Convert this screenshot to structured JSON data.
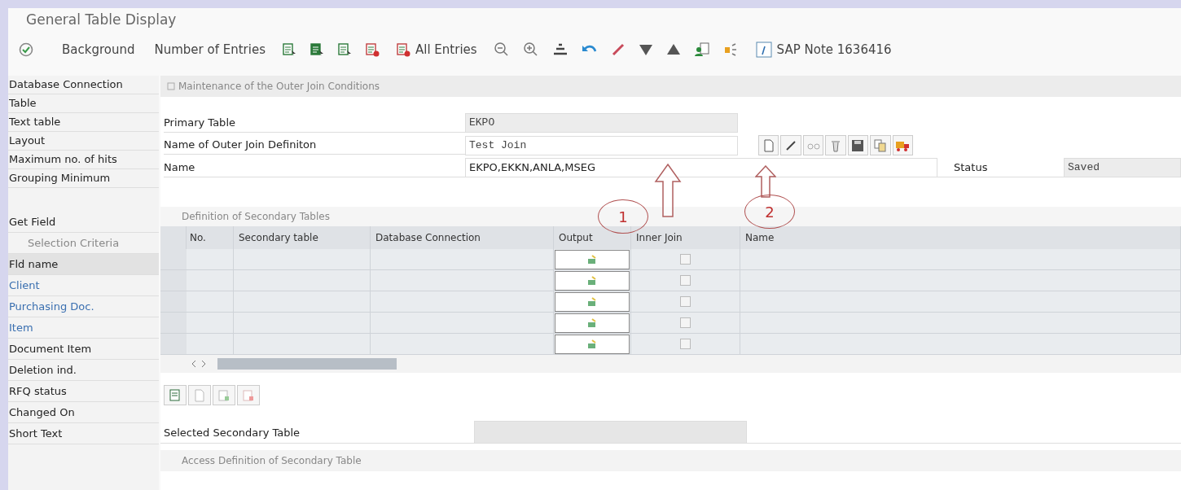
{
  "window": {
    "title": "General Table Display"
  },
  "toolbar": {
    "background": "Background",
    "number_of_entries": "Number of Entries",
    "all_entries": "All Entries",
    "sap_note": "SAP Note 1636416"
  },
  "sidebar": {
    "items": [
      "Database Connection",
      "Table",
      "Text table",
      "Layout",
      "Maximum no. of hits",
      "Grouping Minimum"
    ],
    "get_field": "Get Field",
    "selection_criteria": "Selection Criteria",
    "fields": [
      {
        "name": "Fld name",
        "kind": "heading"
      },
      {
        "name": "Client",
        "kind": "key"
      },
      {
        "name": "Purchasing Doc.",
        "kind": "key"
      },
      {
        "name": "Item",
        "kind": "key"
      },
      {
        "name": "Document Item",
        "kind": "field"
      },
      {
        "name": "Deletion ind.",
        "kind": "field"
      },
      {
        "name": "RFQ status",
        "kind": "field"
      },
      {
        "name": "Changed On",
        "kind": "field"
      },
      {
        "name": "Short Text",
        "kind": "field"
      }
    ]
  },
  "join_form": {
    "title": "Maintenance of the Outer Join Conditions",
    "primary_table": {
      "label": "Primary Table",
      "value": "EKPO"
    },
    "join_definition": {
      "label": "Name of Outer Join Definiton",
      "value": "Test Join"
    },
    "name": {
      "label": "Name",
      "value": "EKPO,EKKN,ANLA,MSEG"
    },
    "status": {
      "label": "Status",
      "value": "Saved"
    }
  },
  "annotations": [
    {
      "label": "1"
    },
    {
      "label": "2"
    }
  ],
  "secondary_tables": {
    "title": "Definition of Secondary Tables",
    "columns": [
      "No.",
      "Secondary table",
      "Database Connection",
      "Output",
      "Inner Join",
      "Name"
    ],
    "rows": [
      {
        "inner_join": false
      },
      {
        "inner_join": false
      },
      {
        "inner_join": false
      },
      {
        "inner_join": false
      },
      {
        "inner_join": false
      }
    ]
  },
  "selected_secondary_table": {
    "label": "Selected Secondary Table"
  },
  "access_definition": {
    "title": "Access Definition of Secondary Table"
  }
}
